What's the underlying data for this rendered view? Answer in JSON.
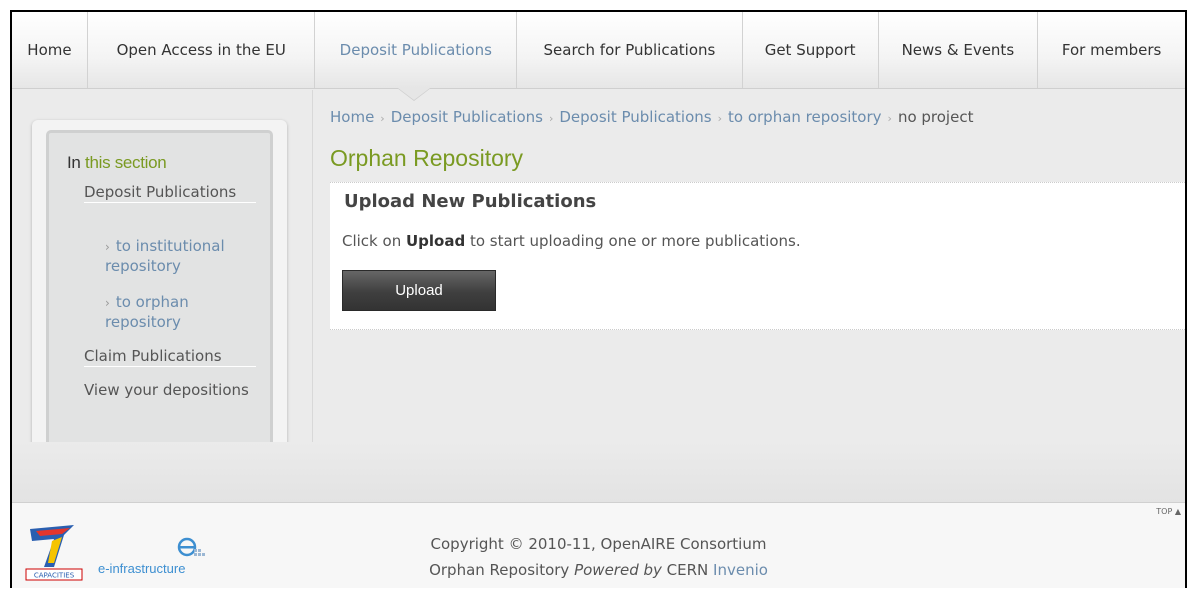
{
  "nav": {
    "items": [
      {
        "label": "Home",
        "active": false
      },
      {
        "label": "Open Access in the EU",
        "active": false
      },
      {
        "label": "Deposit Publications",
        "active": true
      },
      {
        "label": "Search for Publications",
        "active": false
      },
      {
        "label": "Get Support",
        "active": false
      },
      {
        "label": "News & Events",
        "active": false
      },
      {
        "label": "For members",
        "active": false
      }
    ]
  },
  "sidebar": {
    "title_prefix": "In ",
    "title_highlight": "this section",
    "items": [
      {
        "label": "Deposit Publications"
      },
      {
        "label": "to institutional repository"
      },
      {
        "label": "to orphan repository"
      },
      {
        "label": "Claim Publications"
      },
      {
        "label": "View your depositions"
      }
    ]
  },
  "breadcrumb": {
    "items": [
      "Home",
      "Deposit Publications",
      "Deposit Publications",
      "to orphan repository"
    ],
    "current": "no project"
  },
  "page": {
    "title": "Orphan Repository"
  },
  "upload_box": {
    "heading": "Upload New Publications",
    "text_prefix": "Click on ",
    "text_bold": "Upload",
    "text_suffix": " to start uploading one or more publications.",
    "button_label": "Upload"
  },
  "footer": {
    "top_label": "TOP ▲",
    "copyright": "Copyright © 2010-11, OpenAIRE Consortium",
    "powered_prefix": "Orphan Repository ",
    "powered_italic": "Powered by",
    "powered_middle": " CERN ",
    "powered_link": "Invenio",
    "logo_capacities": "CAPACITIES",
    "logo_einfra": "e-infrastructure"
  },
  "colors": {
    "link": "#6b8cad",
    "accent_green": "#7a9a22",
    "button_dark": "#3f3f3f"
  }
}
